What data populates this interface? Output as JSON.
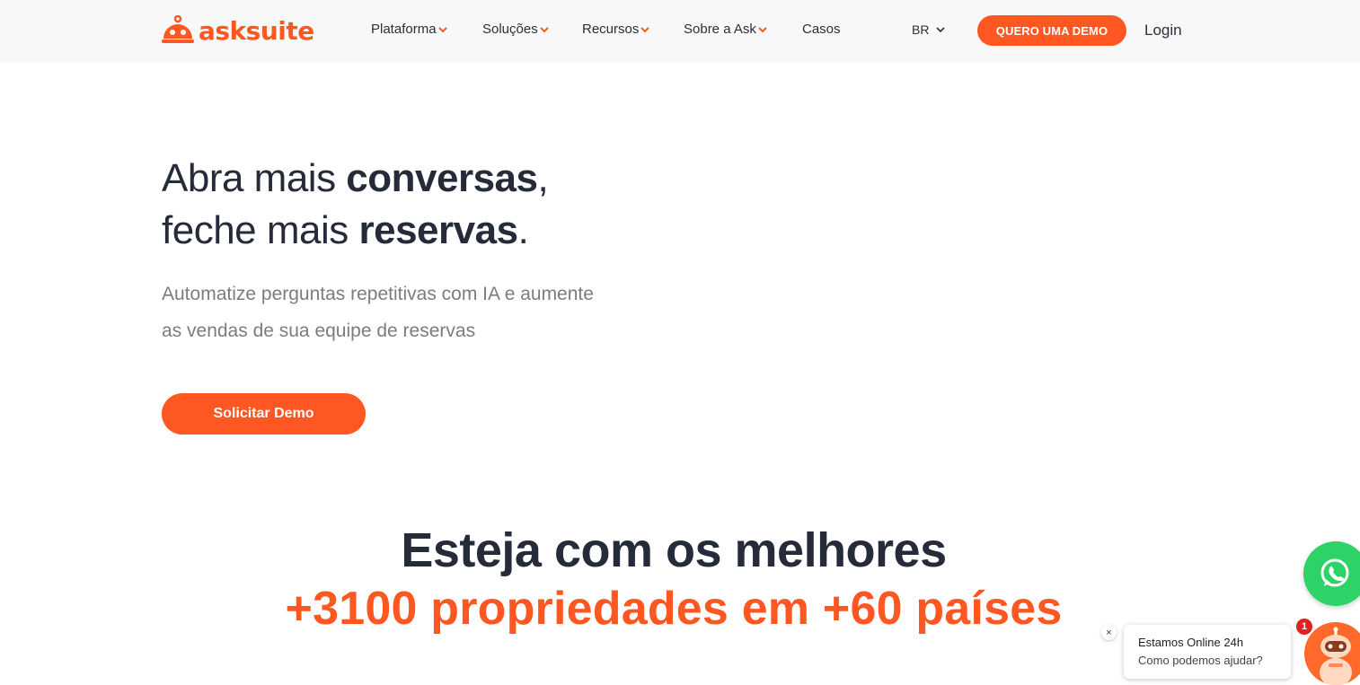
{
  "header": {
    "logo_text": "asksuite",
    "nav": [
      {
        "label": "Plataforma",
        "has_dropdown": true
      },
      {
        "label": "Soluções",
        "has_dropdown": true
      },
      {
        "label": "Recursos",
        "has_dropdown": true
      },
      {
        "label": "Sobre a Ask",
        "has_dropdown": true
      },
      {
        "label": "Casos",
        "has_dropdown": false
      }
    ],
    "language": "BR",
    "demo_button": "QUERO UMA DEMO",
    "login": "Login"
  },
  "hero": {
    "title_line1_normal": "Abra mais ",
    "title_line1_bold": "conversas",
    "title_line1_end": ",",
    "title_line2_normal": "feche mais ",
    "title_line2_bold": "reservas",
    "title_line2_end": ".",
    "subtitle_line1": "Automatize perguntas repetitivas com IA e aumente",
    "subtitle_line2": "as vendas de sua equipe de reservas",
    "cta": "Solicitar Demo"
  },
  "social_proof": {
    "title": "Esteja com os melhores",
    "highlight": "+3100 propriedades em +60 países"
  },
  "chat_widget": {
    "line1": "Estamos Online 24h",
    "line2": "Como podemos ajudar?",
    "close": "×",
    "badge_count": "1"
  },
  "colors": {
    "brand": "#ff5722",
    "dark_text": "#262b3a",
    "whatsapp": "#2dd366"
  },
  "icons": {
    "logo": "bell-robot-icon",
    "dropdown": "chevron-down-icon",
    "whatsapp": "whatsapp-icon",
    "bot": "robot-avatar-icon"
  }
}
